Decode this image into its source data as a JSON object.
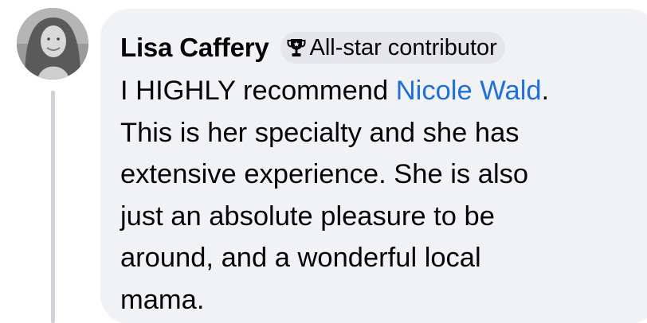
{
  "comment": {
    "author": "Lisa Caffery",
    "badge": {
      "label": "All-star contributor",
      "icon": "trophy-icon"
    },
    "body": {
      "line1_prefix": "I HIGHLY recommend ",
      "mention": "Nicole Wald",
      "line1_suffix": ".",
      "line2": "This is her specialty and she has",
      "line3": "extensive experience. She is also",
      "line4": "just an absolute pleasure to be",
      "line5": "around, and a wonderful local",
      "line6": "mama."
    }
  },
  "colors": {
    "bubble_background": "#f0f2f5",
    "badge_background": "#e4e6eb",
    "mention_link": "#216fdb",
    "text": "#050505"
  }
}
